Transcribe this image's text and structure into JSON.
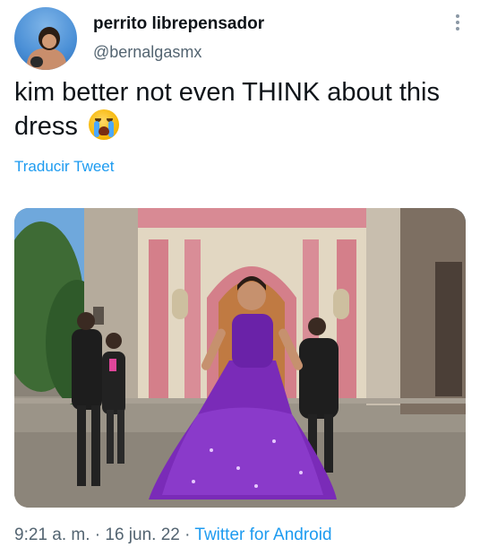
{
  "author": {
    "display_name": "perrito librepensador",
    "handle": "@bernalgasmx"
  },
  "tweet": {
    "text": "kim better not even THINK about this dress",
    "emoji": "loudly-crying-face",
    "translate_label": "Traducir Tweet"
  },
  "meta": {
    "time": "9:21 a. m.",
    "separator": " · ",
    "date": "16 jun. 22",
    "source": "Twitter for Android"
  },
  "colors": {
    "link": "#1d9bf0",
    "secondary_text": "#536471",
    "dress": "#7a2bb8"
  }
}
